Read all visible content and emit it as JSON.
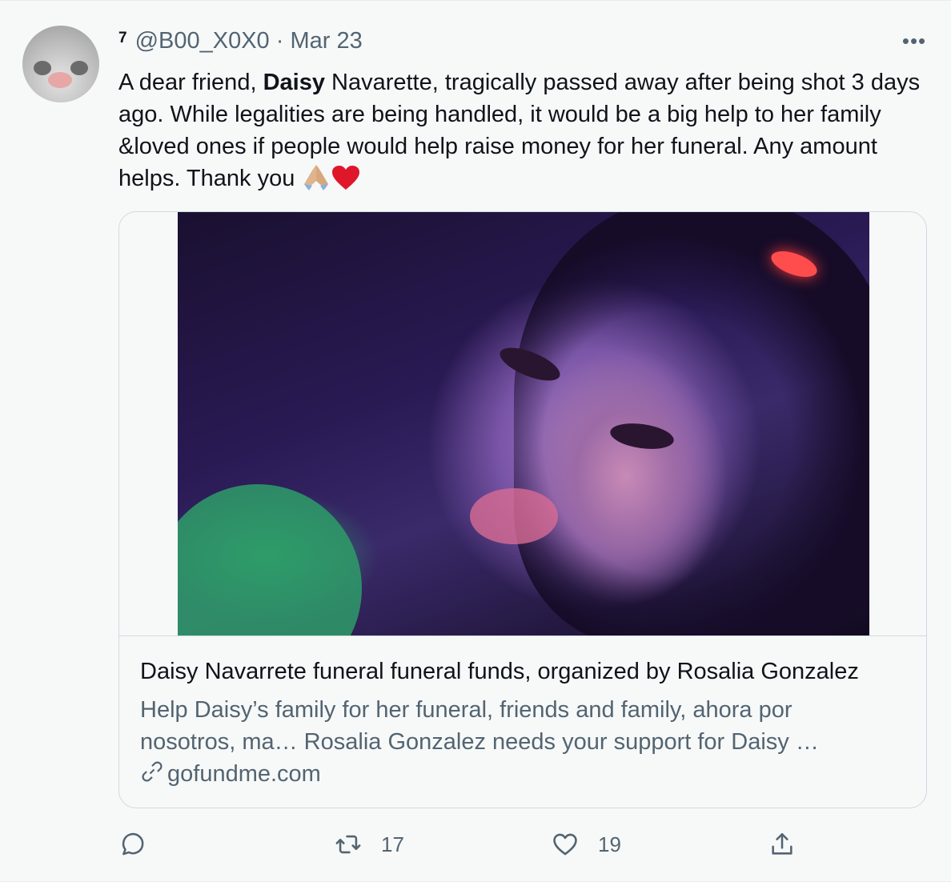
{
  "tweet": {
    "rank_badge": "7",
    "handle": "@B00_X0X0",
    "separator": "·",
    "date": "Mar 23",
    "more_icon": "more-horizontal-icon",
    "text_before": "A dear friend, ",
    "text_bold": "Daisy",
    "text_after": " Navarette, tragically passed away after being shot  3 days ago. While legalities are being handled, it would be a big help to her family &loved ones if people would help raise money for her funeral. Any amount helps. Thank you ",
    "emoji_pray": "🙏🏼",
    "emoji_heart": "❤️"
  },
  "card": {
    "title": "Daisy Navarrete funeral funeral funds, organized by Rosalia Gonzalez",
    "description": "Help Daisy’s family for her funeral, friends and family, ahora por nosotros, ma… Rosalia Gonzalez needs your support for Daisy …",
    "domain": "gofundme.com"
  },
  "actions": {
    "reply_icon": "reply-icon",
    "retweet_icon": "retweet-icon",
    "retweet_count": "17",
    "like_icon": "heart-icon",
    "like_count": "19",
    "share_icon": "share-icon"
  },
  "colors": {
    "background": "#f7f9f9",
    "text": "#0f1419",
    "secondary": "#536471",
    "border": "#cfd9de"
  }
}
